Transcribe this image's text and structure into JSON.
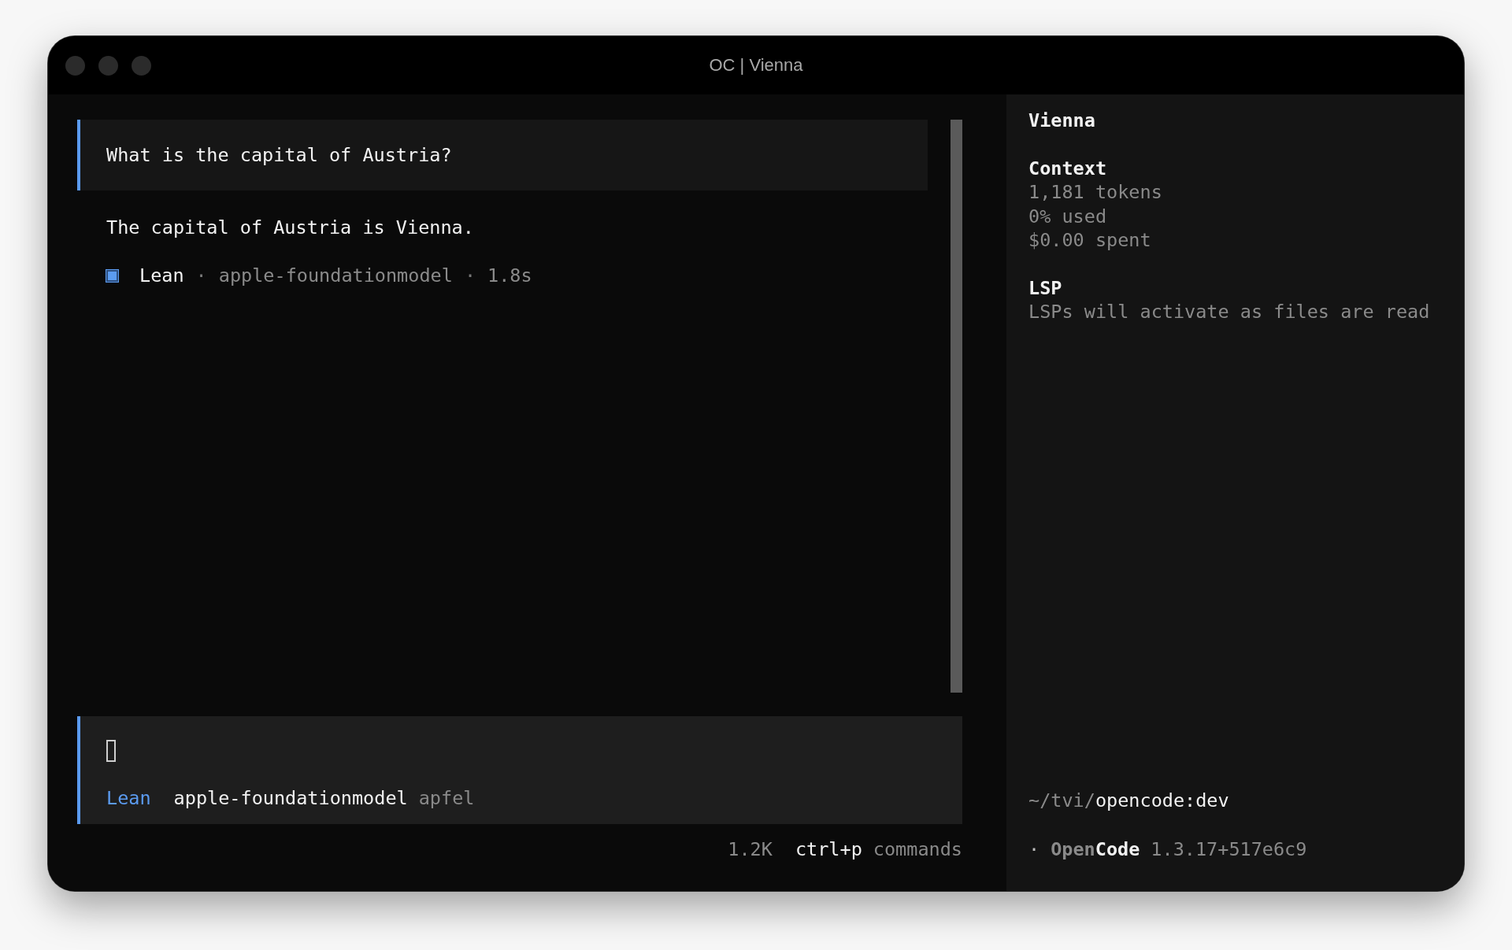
{
  "window": {
    "title": "OC | Vienna"
  },
  "conversation": {
    "messages": [
      {
        "kind": "user",
        "text": "What is the capital of Austria?"
      },
      {
        "kind": "assistant",
        "text": "The capital of Austria is Vienna."
      }
    ],
    "response_meta": {
      "agent": "Lean",
      "separator_1": "·",
      "model": "apple-foundationmodel",
      "separator_2": "·",
      "duration": "1.8s"
    }
  },
  "prompt": {
    "agent": "Lean",
    "model": "apple-foundationmodel",
    "provider": "apfel"
  },
  "footer": {
    "tokens": "1.2K",
    "shortcut": "ctrl+p",
    "shortcut_label": "commands"
  },
  "sidebar": {
    "title": "Vienna",
    "sections": [
      {
        "heading": "Context",
        "lines": [
          "1,181 tokens",
          "0% used",
          "$0.00 spent"
        ]
      },
      {
        "heading": "LSP",
        "lines": [
          "LSPs will activate as files are read"
        ]
      }
    ],
    "path": {
      "prefix": "~/tvi/",
      "name": "opencode:dev"
    },
    "app": {
      "bullet": "·",
      "name_first": "Open",
      "name_second": "Code",
      "version": "1.3.17+517e6c9"
    }
  }
}
